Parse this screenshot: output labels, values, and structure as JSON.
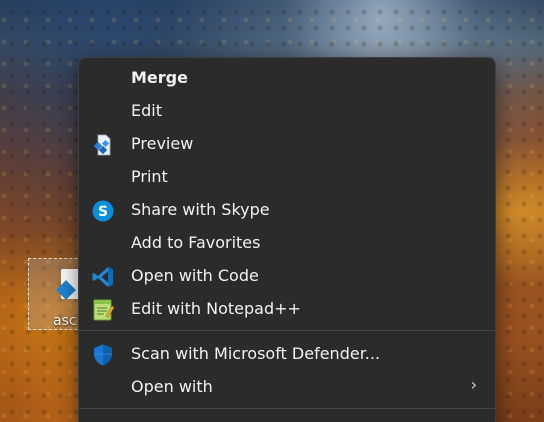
{
  "desktop": {
    "icon_label": "asc"
  },
  "context_menu": {
    "items": [
      {
        "label": "Merge",
        "icon": "none",
        "bold": true
      },
      {
        "label": "Edit",
        "icon": "none"
      },
      {
        "label": "Preview",
        "icon": "preview-icon"
      },
      {
        "label": "Print",
        "icon": "none"
      },
      {
        "label": "Share with Skype",
        "icon": "skype-icon"
      },
      {
        "label": "Add to Favorites",
        "icon": "none"
      },
      {
        "label": "Open with Code",
        "icon": "vscode-icon"
      },
      {
        "label": "Edit with Notepad++",
        "icon": "notepadplusplus-icon"
      },
      {
        "label": "Scan with Microsoft Defender...",
        "icon": "defender-shield-icon"
      },
      {
        "label": "Open with",
        "icon": "none",
        "submenu_indicator": "›"
      }
    ]
  }
}
